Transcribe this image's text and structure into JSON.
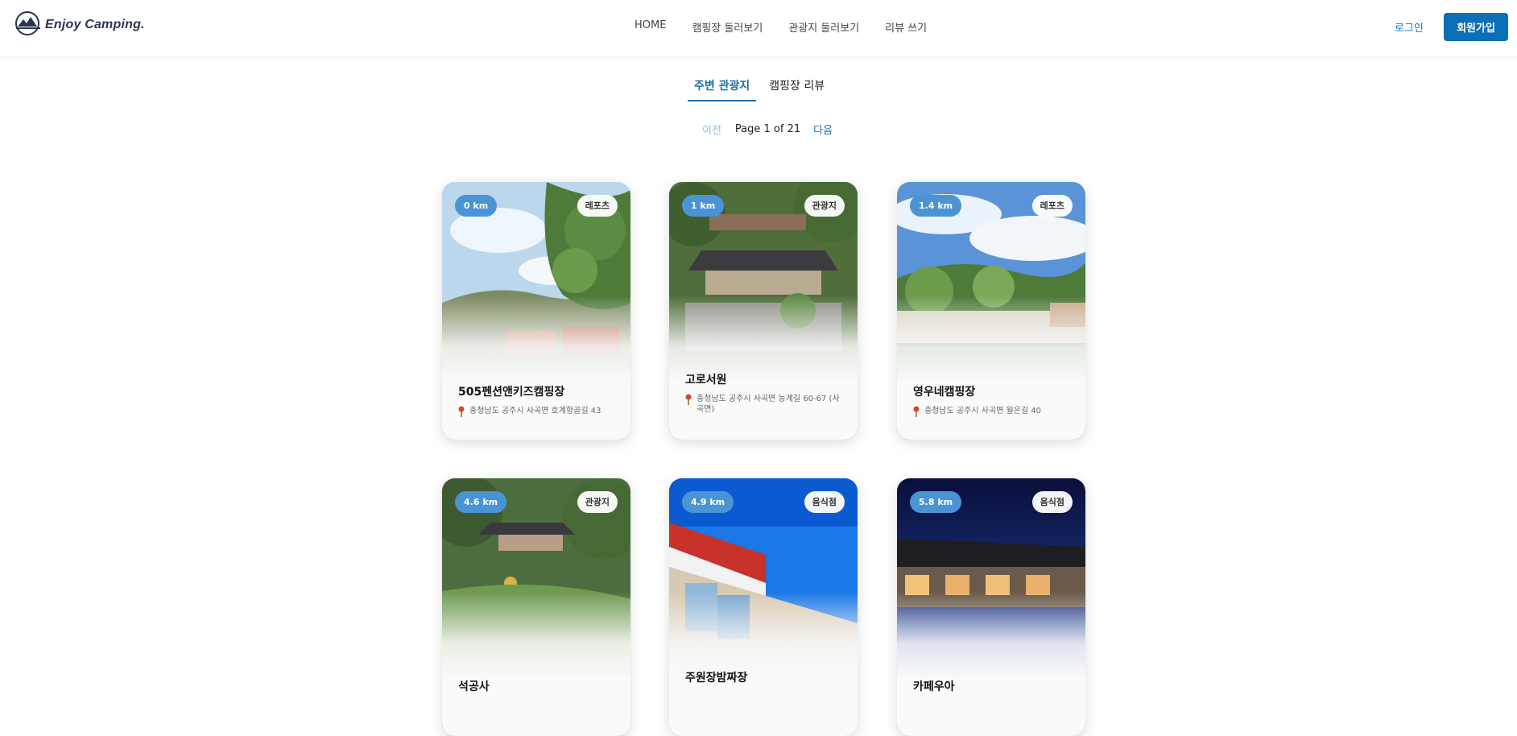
{
  "header": {
    "logo_text": "Enjoy Camping.",
    "logo_icon": "mountain-tent-logo-icon",
    "nav": [
      "HOME",
      "캠핑장 둘러보기",
      "관광지 둘러보기",
      "리뷰 쓰기"
    ],
    "login_label": "로그인",
    "signup_label": "회원가입"
  },
  "tabs": [
    {
      "label": "주변 관광지",
      "active": true
    },
    {
      "label": "캠핑장 리뷰",
      "active": false
    }
  ],
  "pagination": {
    "prev_label": "이전",
    "info": "Page 1 of 21",
    "next_label": "다음"
  },
  "cards": [
    {
      "distance": "0 km",
      "category": "레포츠",
      "title": "505펜션앤키즈캠핑장",
      "address": "충청남도 공주시 사곡면 호계항골길 43",
      "image": "forest-campsite"
    },
    {
      "distance": "1 km",
      "category": "관광지",
      "title": "고로서원",
      "address": "충청남도 공주시 사곡면 능계길 60-67 (사곡면)",
      "image": "traditional-hanok"
    },
    {
      "distance": "1.4 km",
      "category": "레포츠",
      "title": "영우네캠핑장",
      "address": "충청남도 공주시 사곡면 월은길 40",
      "image": "sky-campsite"
    },
    {
      "distance": "4.6 km",
      "category": "관광지",
      "title": "석공사",
      "address": "",
      "image": "temple-buddha"
    },
    {
      "distance": "4.9 km",
      "category": "음식점",
      "title": "주원장밤짜장",
      "address": "",
      "image": "restaurant-sign"
    },
    {
      "distance": "5.8 km",
      "category": "음식점",
      "title": "카페우아",
      "address": "",
      "image": "night-hanok-cafe"
    }
  ],
  "icons": {
    "address": "map-pin-icon"
  },
  "colors": {
    "brand": "#0b6fb5",
    "distance_badge": "#4a94d6",
    "tab_active": "#1a6fa8"
  }
}
